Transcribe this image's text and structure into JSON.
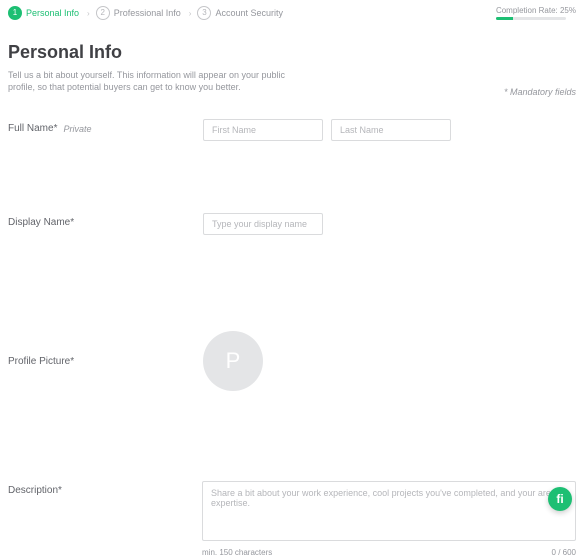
{
  "stepper": {
    "steps": [
      {
        "num": "1",
        "label": "Personal Info"
      },
      {
        "num": "2",
        "label": "Professional Info"
      },
      {
        "num": "3",
        "label": "Account Security"
      }
    ]
  },
  "completion": {
    "text": "Completion Rate: 25%"
  },
  "title": "Personal Info",
  "intro": "Tell us a bit about yourself. This information will appear on your public profile, so that potential buyers can get to know you better.",
  "mandatory": "* Mandatory fields",
  "fields": {
    "fullname": {
      "label": "Full Name",
      "private": "Private",
      "first_placeholder": "First Name",
      "last_placeholder": "Last Name"
    },
    "display": {
      "label": "Display Name",
      "placeholder": "Type your display name"
    },
    "picture": {
      "label": "Profile Picture",
      "initial": "P"
    },
    "description": {
      "label": "Description",
      "placeholder": "Share a bit about your work experience, cool projects you've completed, and your area of expertise.",
      "min": "min. 150 characters",
      "counter": "0 / 600"
    }
  },
  "fab": {
    "letter": "fi"
  }
}
